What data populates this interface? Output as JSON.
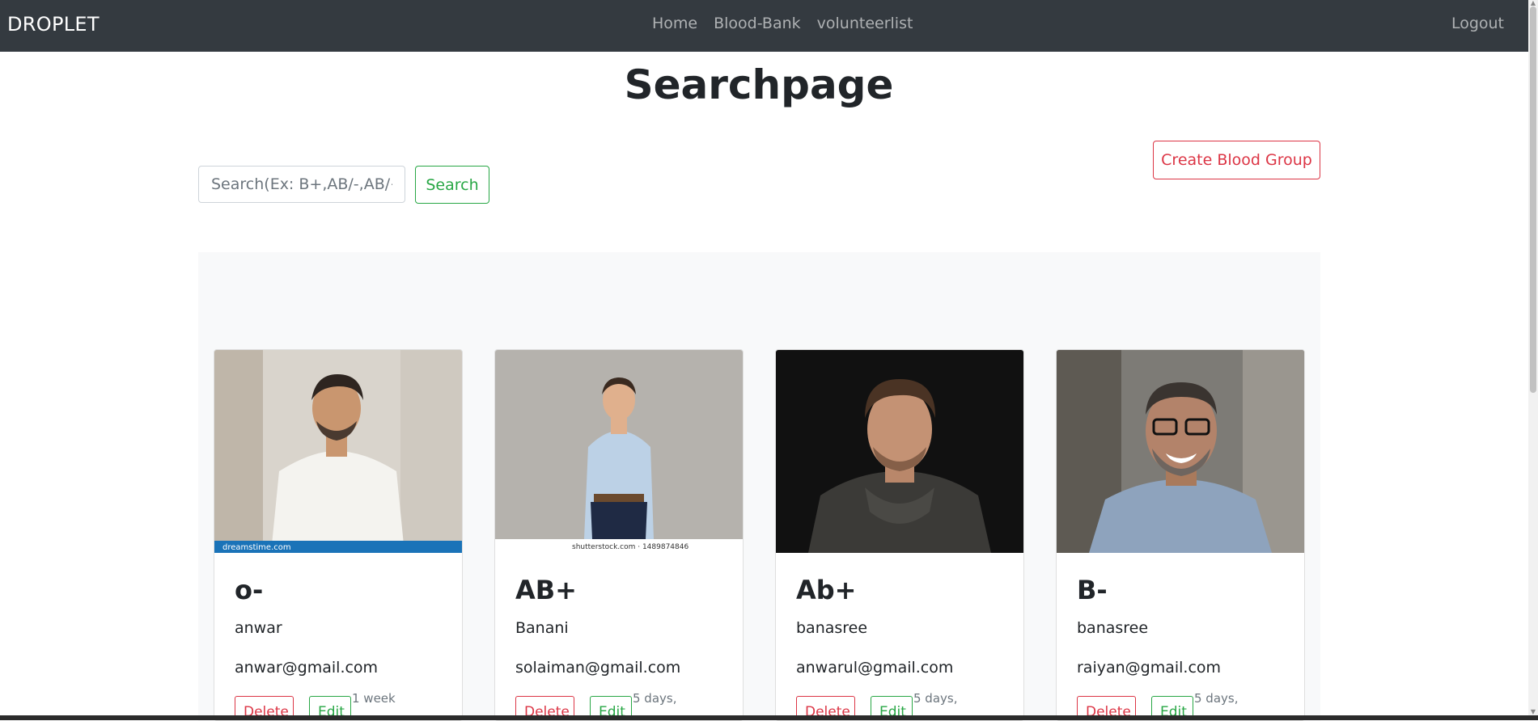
{
  "nav": {
    "brand": "DROPLET",
    "links": [
      "Home",
      "Blood-Bank",
      "volunteerlist"
    ],
    "logout": "Logout"
  },
  "page": {
    "title": "Searchpage",
    "search_placeholder": "Search(Ex: B+,AB/-,AB/+)",
    "search_button": "Search",
    "create_button": "Create Blood Group"
  },
  "cards": [
    {
      "group": "o-",
      "name": "anwar",
      "email": "anwar@gmail.com",
      "delete": "Delete",
      "edit": "Edit",
      "time": "1 week"
    },
    {
      "group": "AB+",
      "name": "Banani",
      "email": "solaiman@gmail.com",
      "delete": "Delete",
      "edit": "Edit",
      "time": "5 days,"
    },
    {
      "group": "Ab+",
      "name": "banasree",
      "email": "anwarul@gmail.com",
      "delete": "Delete",
      "edit": "Edit",
      "time": "5 days,"
    },
    {
      "group": "B-",
      "name": "banasree",
      "email": "raiyan@gmail.com",
      "delete": "Delete",
      "edit": "Edit",
      "time": "5 days,"
    }
  ],
  "photo_captions": [
    "dreamstime.com",
    "shutterstock.com · 1489874846"
  ],
  "colors": {
    "navbar": "#343a40",
    "danger": "#dc3545",
    "success": "#28a745"
  }
}
